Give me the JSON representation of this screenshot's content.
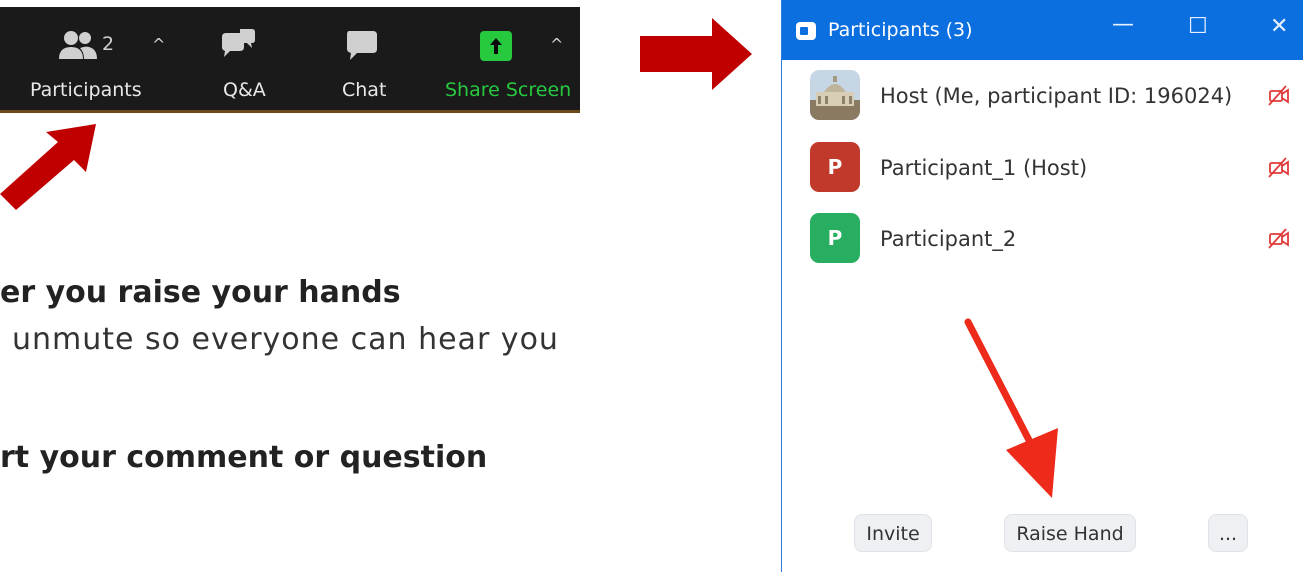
{
  "toolbar": {
    "participants_label": "Participants",
    "participants_count": "2",
    "qa_label": "Q&A",
    "chat_label": "Chat",
    "share_label": "Share Screen",
    "caret": "^"
  },
  "slide": {
    "line1": "er you raise your hands",
    "line2": "unmute so everyone can hear you",
    "line3": "rt your comment or question"
  },
  "window": {
    "title": "Participants (3)",
    "minimize": "—",
    "maximize": "☐",
    "close": "✕",
    "participants": [
      {
        "name": "Host (Me, participant ID: 196024)",
        "initial": ""
      },
      {
        "name": "Participant_1 (Host)",
        "initial": "P"
      },
      {
        "name": "Participant_2",
        "initial": "P"
      }
    ],
    "buttons": {
      "invite": "Invite",
      "raise_hand": "Raise Hand",
      "more": "..."
    }
  },
  "colors": {
    "arrow": "#c00000",
    "toolbar_bg": "#1a1a1a",
    "share_green": "#27c93f",
    "title_blue": "#0b6fe0",
    "avatar_red": "#c0392b",
    "avatar_green": "#27ae60",
    "mute_red": "#e03a3a"
  }
}
